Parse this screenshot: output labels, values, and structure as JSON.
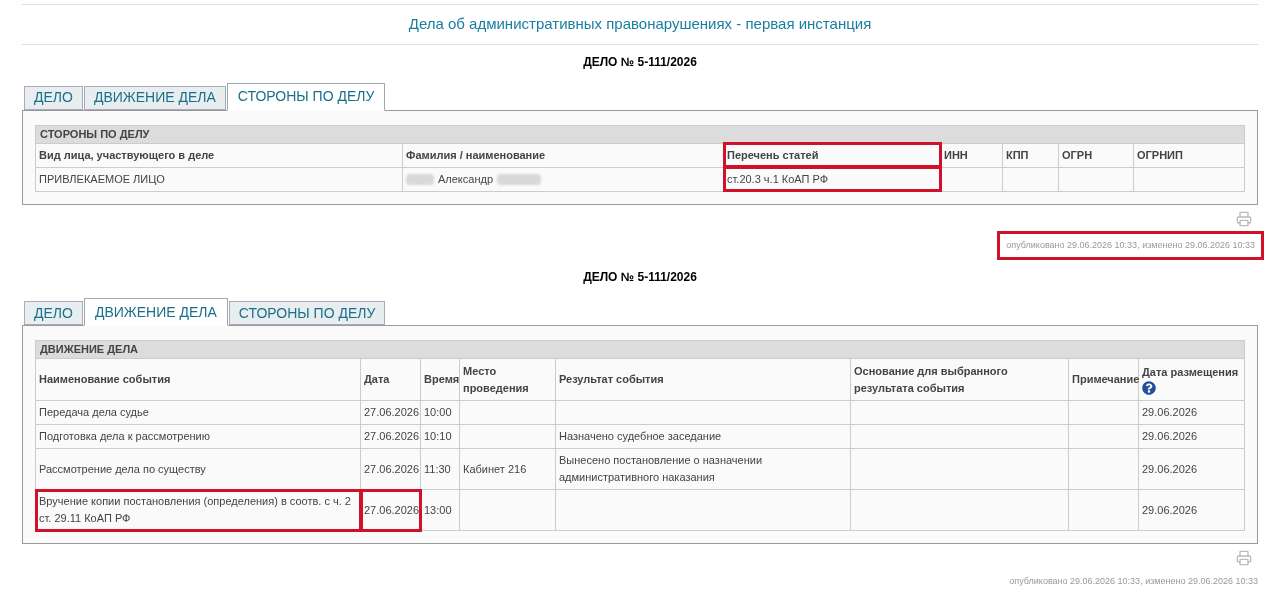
{
  "page_title": "Дела об административных правонарушениях - первая инстанция",
  "sections": [
    {
      "case_heading": "ДЕЛО № 5-111/2026",
      "tabs": [
        {
          "label": "ДЕЛО",
          "selected": false
        },
        {
          "label": "ДВИЖЕНИЕ ДЕЛА",
          "selected": false
        },
        {
          "label": "СТОРОНЫ ПО ДЕЛУ",
          "selected": true
        }
      ],
      "table": {
        "caption": "СТОРОНЫ ПО ДЕЛУ",
        "columns": [
          {
            "label": "Вид лица, участвующего в деле",
            "highlighted": false
          },
          {
            "label": "Фамилия / наименование",
            "highlighted": false
          },
          {
            "label": "Перечень статей",
            "highlighted": true
          },
          {
            "label": "ИНН",
            "highlighted": false
          },
          {
            "label": "КПП",
            "highlighted": false
          },
          {
            "label": "ОГРН",
            "highlighted": false
          },
          {
            "label": "ОГРНИП",
            "highlighted": false
          }
        ],
        "rows": [
          {
            "cells": [
              {
                "text": "ПРИВЛЕКАЕМОЕ ЛИЦО",
                "highlighted": false
              },
              {
                "text": "Александр",
                "highlighted": false,
                "redacted": true
              },
              {
                "text": "ст.20.3 ч.1 КоАП РФ",
                "highlighted": true
              },
              {
                "highlighted": false
              },
              {
                "highlighted": false
              },
              {
                "highlighted": false
              },
              {
                "highlighted": false
              }
            ]
          }
        ]
      },
      "published": {
        "text": "опубликовано 29.06.2026 10:33, изменено 29.06.2026 10:33",
        "highlighted": true
      }
    },
    {
      "case_heading": "ДЕЛО № 5-111/2026",
      "tabs": [
        {
          "label": "ДЕЛО",
          "selected": false
        },
        {
          "label": "ДВИЖЕНИЕ ДЕЛА",
          "selected": true
        },
        {
          "label": "СТОРОНЫ ПО ДЕЛУ",
          "selected": false
        }
      ],
      "table": {
        "caption": "ДВИЖЕНИЕ ДЕЛА",
        "columns": [
          {
            "label": "Наименование события",
            "highlighted": false
          },
          {
            "label": "Дата",
            "highlighted": false
          },
          {
            "label": "Время",
            "highlighted": false
          },
          {
            "label": "Место проведения",
            "highlighted": false
          },
          {
            "label": "Результат события",
            "highlighted": false
          },
          {
            "label": "Основание для выбранного результата события",
            "highlighted": false
          },
          {
            "label": "Примечание",
            "highlighted": false
          },
          {
            "label": "Дата размещения",
            "highlighted": false,
            "help": true
          }
        ],
        "rows": [
          {
            "cells": [
              {
                "text": "Передача дела судье",
                "highlighted": false
              },
              {
                "text": "27.06.2026",
                "highlighted": false
              },
              {
                "text": "10:00",
                "highlighted": false
              },
              {
                "highlighted": false
              },
              {
                "highlighted": false
              },
              {
                "highlighted": false
              },
              {
                "highlighted": false
              },
              {
                "text": "29.06.2026",
                "highlighted": false
              }
            ]
          },
          {
            "cells": [
              {
                "text": "Подготовка дела к рассмотрению",
                "highlighted": false
              },
              {
                "text": "27.06.2026",
                "highlighted": false
              },
              {
                "text": "10:10",
                "highlighted": false
              },
              {
                "highlighted": false
              },
              {
                "text": "Назначено судебное заседание",
                "highlighted": false
              },
              {
                "highlighted": false
              },
              {
                "highlighted": false
              },
              {
                "text": "29.06.2026",
                "highlighted": false
              }
            ]
          },
          {
            "cells": [
              {
                "text": "Рассмотрение дела по существу",
                "highlighted": false
              },
              {
                "text": "27.06.2026",
                "highlighted": false
              },
              {
                "text": "11:30",
                "highlighted": false
              },
              {
                "text": "Кабинет 216",
                "highlighted": false
              },
              {
                "text": "Вынесено постановление о назначении административного наказания",
                "highlighted": false
              },
              {
                "highlighted": false
              },
              {
                "highlighted": false
              },
              {
                "text": "29.06.2026",
                "highlighted": false
              }
            ]
          },
          {
            "cells": [
              {
                "text": "Вручение копии постановления (определения) в соотв. с ч. 2 ст. 29.11 КоАП РФ",
                "highlighted": true
              },
              {
                "text": "27.06.2026",
                "highlighted": true
              },
              {
                "text": "13:00",
                "highlighted": false
              },
              {
                "highlighted": false
              },
              {
                "highlighted": false
              },
              {
                "highlighted": false
              },
              {
                "highlighted": false
              },
              {
                "text": "29.06.2026",
                "highlighted": false
              }
            ]
          }
        ]
      },
      "published": {
        "text": "опубликовано 29.06.2026 10:33, изменено 29.06.2026 10:33",
        "highlighted": false
      }
    }
  ]
}
